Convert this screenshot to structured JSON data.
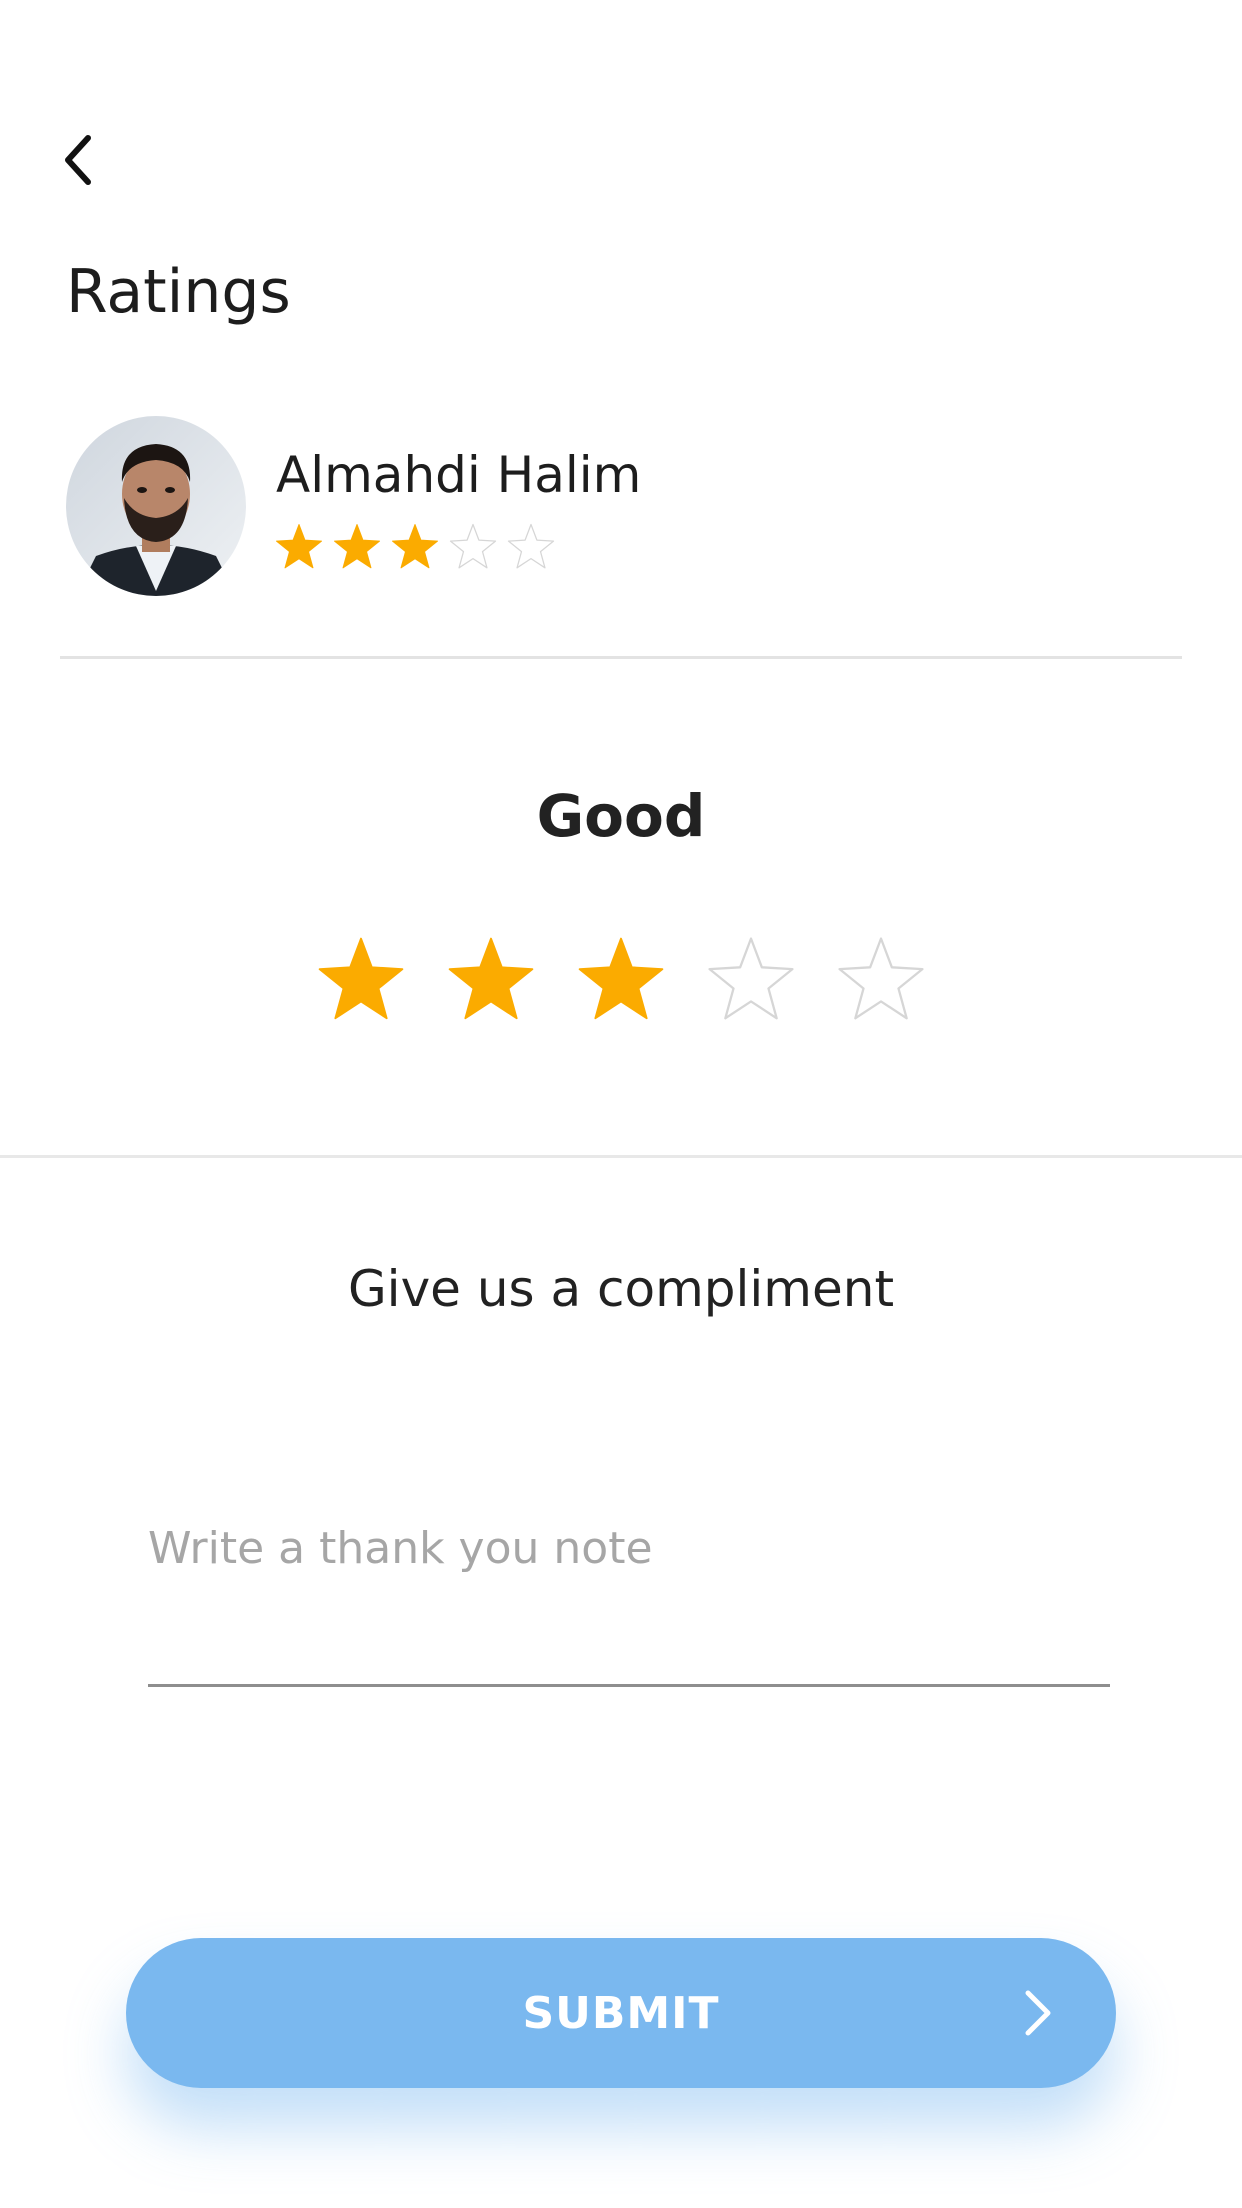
{
  "header": {
    "back_icon": "chevron-left-icon",
    "title": "Ratings"
  },
  "driver": {
    "name": "Almahdi Halim",
    "avatar_icon": "avatar-photo",
    "rating": 3,
    "max_rating": 5
  },
  "rating_section": {
    "label": "Good",
    "selected_stars": 3,
    "max_stars": 5
  },
  "compliment": {
    "title": "Give us a compliment",
    "placeholder": "Write a thank you note",
    "value": ""
  },
  "submit": {
    "label": "SUBMIT",
    "icon": "chevron-right-icon"
  },
  "colors": {
    "star_filled": "#fbab00",
    "star_empty_stroke": "#d6d6d6",
    "button": "#7ab8ef",
    "divider": "#e3e3e3"
  }
}
